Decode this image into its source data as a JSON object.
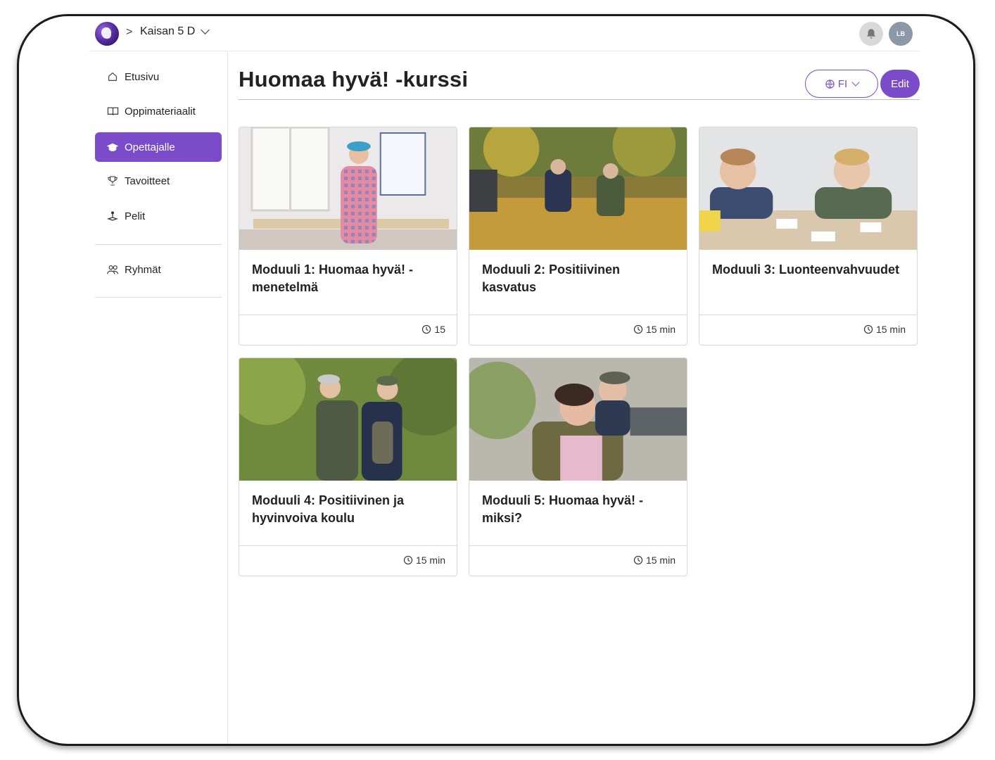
{
  "topbar": {
    "group_name": "Kaisan 5 D",
    "crumb_separator": ">",
    "avatar_initials": "LB"
  },
  "sidebar": {
    "items": [
      {
        "label": "Etusivu",
        "icon": "home-icon"
      },
      {
        "label": "Oppimateriaalit",
        "icon": "book-icon"
      },
      {
        "label": "Opettajalle",
        "icon": "graduation-cap-icon",
        "active": true
      },
      {
        "label": "Tavoitteet",
        "icon": "trophy-icon"
      },
      {
        "label": "Pelit",
        "icon": "joystick-icon"
      },
      {
        "label": "Ryhmät",
        "icon": "people-icon"
      }
    ]
  },
  "main": {
    "title": "Huomaa hyvä! -kurssi",
    "language_label": "FI",
    "edit_label": "Edit",
    "modules": [
      {
        "title": "Moduuli 1: Huomaa hyvä! -menetelmä",
        "duration": "15"
      },
      {
        "title": "Moduuli 2: Positiivinen kasvatus",
        "duration": "15 min"
      },
      {
        "title": "Moduuli 3: Luonteenvahvuudet",
        "duration": "15 min"
      },
      {
        "title": "Moduuli 4: Positiivinen ja hyvinvoiva koulu",
        "duration": "15 min"
      },
      {
        "title": "Moduuli 5: Huomaa hyvä! -miksi?",
        "duration": "15 min"
      }
    ]
  },
  "colors": {
    "accent": "#7a4cc9",
    "border": "#d8d8d8"
  }
}
